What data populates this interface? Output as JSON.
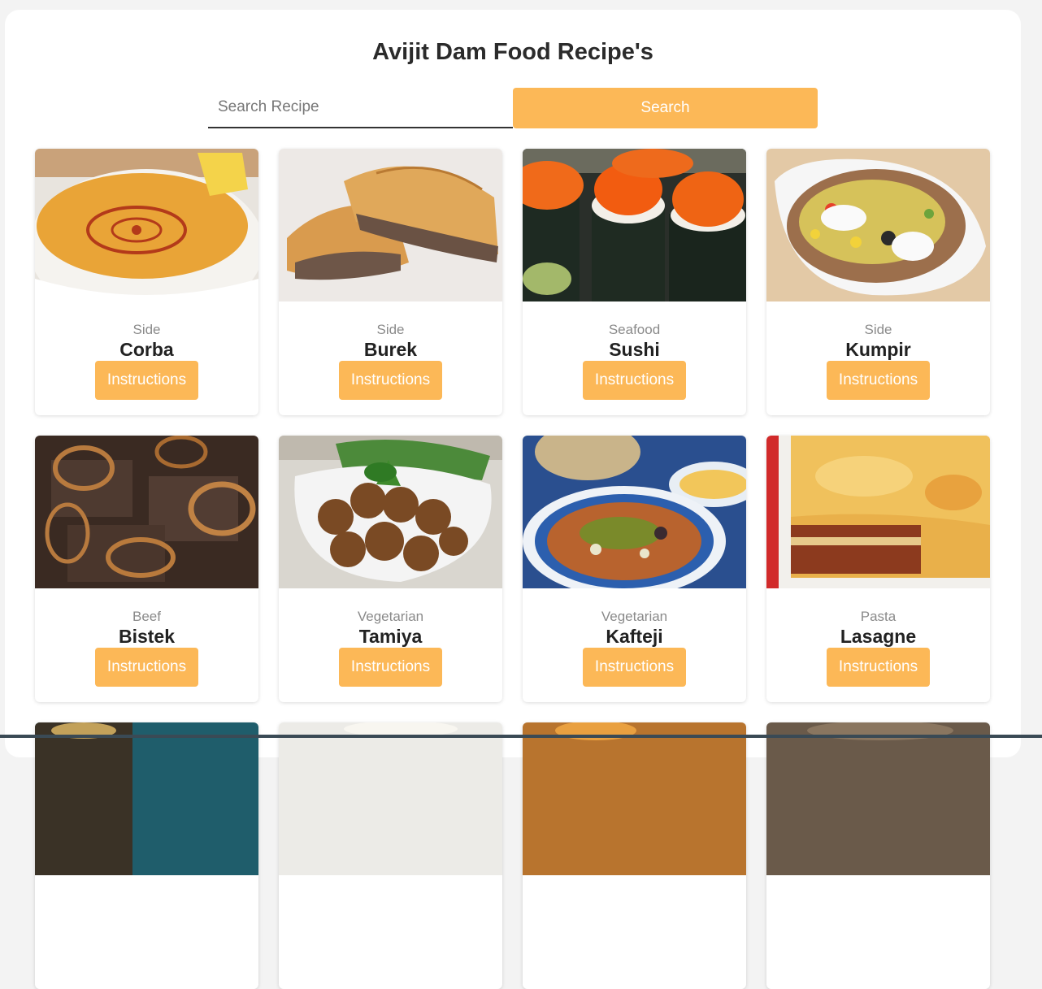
{
  "header": {
    "title": "Avijit Dam Food Recipe's"
  },
  "search": {
    "placeholder": "Search Recipe",
    "value": "",
    "button_label": "Search"
  },
  "recipes": [
    {
      "category": "Side",
      "name": "Corba",
      "button_label": "Instructions",
      "image": "soup-bowl"
    },
    {
      "category": "Side",
      "name": "Burek",
      "button_label": "Instructions",
      "image": "meat-pastry"
    },
    {
      "category": "Seafood",
      "name": "Sushi",
      "button_label": "Instructions",
      "image": "sushi-rolls"
    },
    {
      "category": "Side",
      "name": "Kumpir",
      "button_label": "Instructions",
      "image": "stuffed-potato"
    },
    {
      "category": "Beef",
      "name": "Bistek",
      "button_label": "Instructions",
      "image": "beef-onions"
    },
    {
      "category": "Vegetarian",
      "name": "Tamiya",
      "button_label": "Instructions",
      "image": "falafel-plate"
    },
    {
      "category": "Vegetarian",
      "name": "Kafteji",
      "button_label": "Instructions",
      "image": "vegetable-dish"
    },
    {
      "category": "Pasta",
      "name": "Lasagne",
      "button_label": "Instructions",
      "image": "lasagne-tray"
    }
  ],
  "colors": {
    "accent": "#fcb857",
    "page_bg": "#f3f3f3",
    "card_bg": "#ffffff"
  }
}
